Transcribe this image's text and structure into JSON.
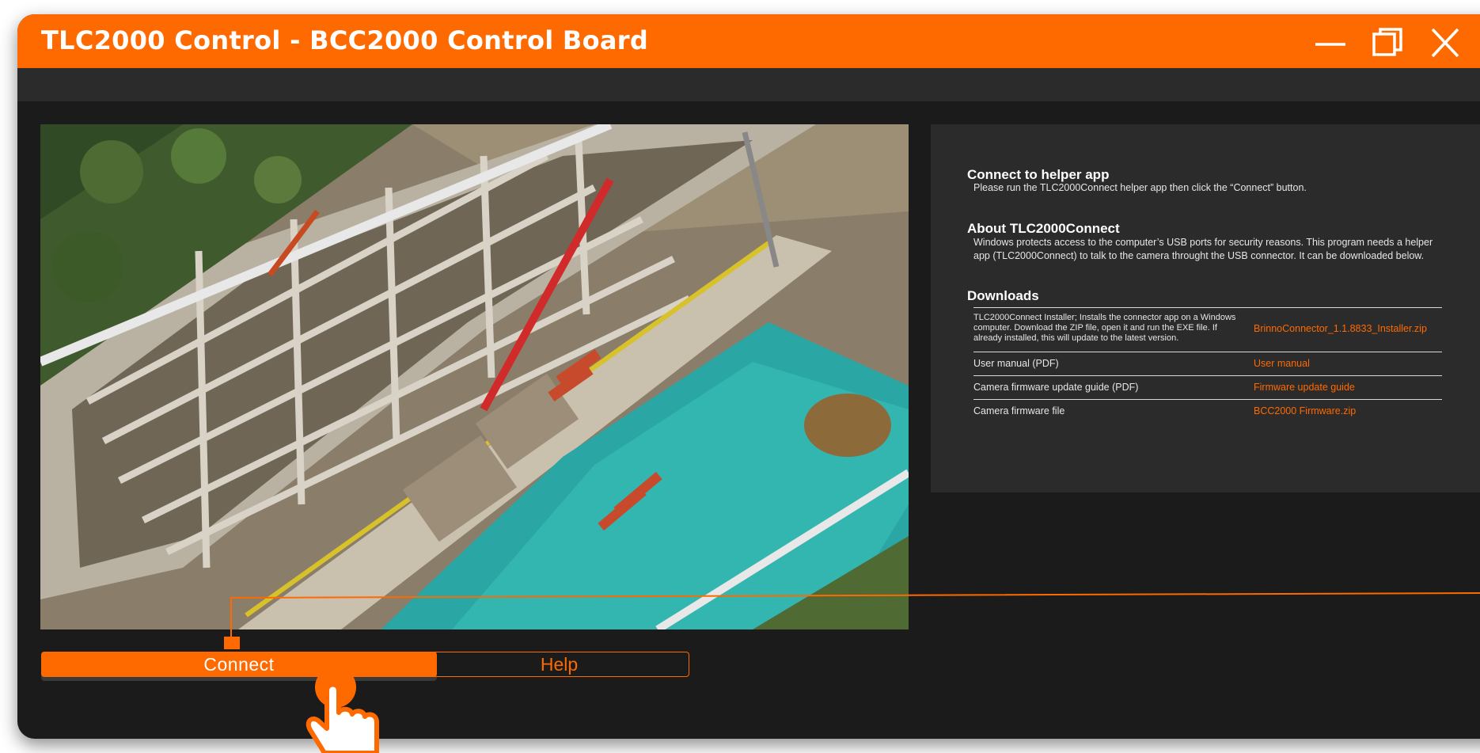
{
  "window": {
    "title": "TLC2000 Control - BCC2000 Control Board",
    "controls": [
      "minimize-icon",
      "maximize-icon",
      "close-icon"
    ]
  },
  "photo": {
    "subject": "aerial construction site",
    "icon": "construction-site-photo"
  },
  "info": {
    "connect": {
      "title": "Connect to helper app",
      "text": "Please run the TLC2000Connect helper app then click the “Connect” button."
    },
    "about": {
      "title": "About TLC2000Connect",
      "text": "Windows protects access to the computer’s USB ports for security reasons. This program needs a helper app (TLC2000Connect) to talk to the camera throught the USB connector. It can be downloaded below."
    },
    "downloads": {
      "title": "Downloads",
      "rows": [
        {
          "desc": "TLC2000Connect Installer; Installs the connector app on a Windows computer. Download the ZIP file, open it and run the EXE file. If already installed, this will update to the latest version.",
          "link": "BrinnoConnector_1.1.8833_Installer.zip"
        },
        {
          "desc": "User manual (PDF)",
          "link": "User manual"
        },
        {
          "desc": "Camera firmware update guide (PDF)",
          "link": "Firmware update guide"
        },
        {
          "desc": "Camera firmware file",
          "link": "BCC2000 Firmware.zip"
        }
      ]
    }
  },
  "buttons": {
    "connect": "Connect",
    "help": "Help"
  },
  "colors": {
    "accent": "#ff6a00",
    "window_bg": "#1b1b1b",
    "panel_bg": "#2b2b2b",
    "text": "#ffffff"
  },
  "cursor": {
    "icon": "hand-pointer-icon"
  }
}
